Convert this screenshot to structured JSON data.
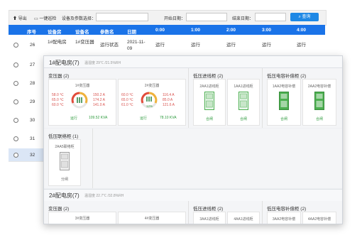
{
  "toolbar": {
    "export_label": "导出",
    "inspect_label": "一键巡检",
    "device_select_label": "设备及参数选择：",
    "start_date_label": "开始日期：",
    "end_date_label": "结束日期：",
    "search_label": "查询",
    "device_value": "",
    "start_value": "",
    "end_value": ""
  },
  "table": {
    "headers": [
      "序号",
      "设备房",
      "设备名",
      "参数名",
      "日期",
      "0:00",
      "1:00",
      "2:00",
      "3:00",
      "4:00"
    ],
    "rows": [
      {
        "no": "26",
        "room": "1#配电房",
        "device": "1#变压器",
        "param": "运行状态",
        "date": "2021-11-09",
        "v0": "运行",
        "v1": "运行",
        "v2": "运行",
        "v3": "运行",
        "v4": "运行"
      },
      {
        "no": "27"
      },
      {
        "no": "28"
      },
      {
        "no": "29"
      },
      {
        "no": "30"
      },
      {
        "no": "31"
      },
      {
        "no": "32"
      }
    ]
  },
  "popup": {
    "room1": {
      "title": "1#配电房(7)",
      "climate": "温湿度 29℃ /21.5%RH",
      "transformer_panel": "变压器 (2)",
      "transformers": [
        {
          "name": "1#变压器",
          "temps": [
            "58.0 ℃",
            "65.0 ℃",
            "60.0 ℃"
          ],
          "currents": [
            "150.2 A",
            "174.2 A",
            "141.0 A"
          ],
          "load_pct": 0,
          "load_label": "",
          "status": "运行",
          "power": "109.52 KVA"
        },
        {
          "name": "2#变压器",
          "temps": [
            "60.0 ℃",
            "65.0 ℃",
            "61.0 ℃"
          ],
          "currents": [
            "116.4 A",
            "85.0 A",
            "121.6 A"
          ],
          "load_pct": 12,
          "load_label": "12%",
          "status": "运行",
          "power": "78.10 KVA"
        }
      ],
      "incoming_panel": "低压进线柜 (2)",
      "incoming": [
        {
          "name": "2AA1进线柜",
          "status": "合闸"
        },
        {
          "name": "1AA1进线柜",
          "status": "合闸"
        }
      ],
      "capacitor_panel": "低压电容补偿柜 (2)",
      "capacitors": [
        {
          "name": "1AA2电容补偿",
          "status": "合闸"
        },
        {
          "name": "2AA2电容补偿",
          "status": "合闸"
        }
      ],
      "tie_panel": "低压联络柜 (1)",
      "tie": {
        "name": "2AA5联络柜",
        "status": "分闸"
      }
    },
    "room2": {
      "title": "2#配电房(7)",
      "climate": "温湿度 22.7℃ /32.8%RH",
      "transformer_panel": "变压器 (2)",
      "transformers": [
        "3#变压器",
        "4#变压器"
      ],
      "incoming_panel": "低压进线柜 (2)",
      "incoming": [
        "3AA1进线柜",
        "4AA1进线柜"
      ],
      "capacitor_panel": "低压电容补偿柜 (2)",
      "capacitors": [
        "3AA2电容补偿",
        "4AA2电容补偿"
      ]
    }
  },
  "colors": {
    "header_blue": "#1a73e8",
    "run_green": "#2e9b3e",
    "alarm_red": "#d9534f"
  },
  "icons": [
    "export-icon",
    "monitor-icon",
    "search-icon",
    "cabinet-icon"
  ]
}
